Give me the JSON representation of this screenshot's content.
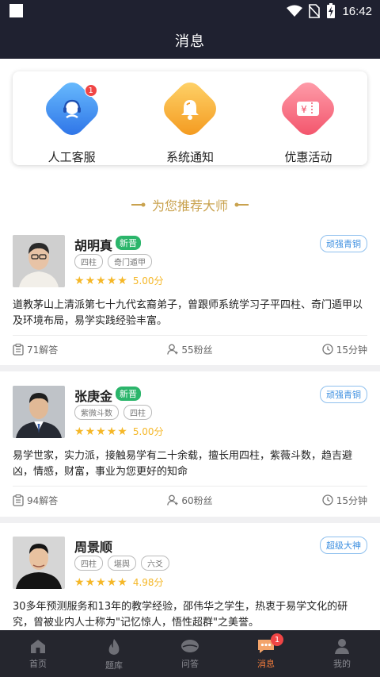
{
  "status_bar": {
    "time": "16:42"
  },
  "header": {
    "title": "消息"
  },
  "quick_actions": [
    {
      "label": "人工客服",
      "icon": "customer-service-icon",
      "badge": "1",
      "color_top": "#5fb4ff",
      "color_bottom": "#2b74e8"
    },
    {
      "label": "系统通知",
      "icon": "bell-icon",
      "color_top": "#ffd36a",
      "color_bottom": "#f49a1c"
    },
    {
      "label": "优惠活动",
      "icon": "coupon-icon",
      "color_top": "#ff9aa6",
      "color_bottom": "#f3556b"
    }
  ],
  "recommend_title": "为您推荐大师",
  "masters": [
    {
      "name": "胡明真",
      "new_tag": "新晋",
      "level": "顽强青铜",
      "tags": [
        "四柱",
        "奇门遁甲"
      ],
      "score": "5.00分",
      "rating": 5,
      "desc": "道教茅山上清派第七十九代玄裔弟子，曾跟师系统学习子平四柱、奇门遁甲以及环境布局，易学实践经验丰富。",
      "answers": "71解答",
      "fans": "55粉丝",
      "time": "15分钟"
    },
    {
      "name": "张庚金",
      "new_tag": "新晋",
      "level": "顽强青铜",
      "tags": [
        "紫微斗数",
        "四柱"
      ],
      "score": "5.00分",
      "rating": 5,
      "desc": "易学世家，实力派，接触易学有二十余载，擅长用四柱，紫薇斗数，趋吉避凶，情感，财富，事业为您更好的知命",
      "answers": "94解答",
      "fans": "60粉丝",
      "time": "15分钟"
    },
    {
      "name": "周景顺",
      "level": "超级大神",
      "tags": [
        "四柱",
        "堪舆",
        "六爻"
      ],
      "score": "4.98分",
      "rating": 5,
      "desc": "30多年预测服务和13年的教学经验，邵伟华之学生，热衷于易学文化的研究，曾被业内人士称为\"记忆惊人，悟性超群\"之美誉。"
    }
  ],
  "tabs": [
    {
      "label": "首页",
      "icon": "home-icon"
    },
    {
      "label": "题库",
      "icon": "flame-icon"
    },
    {
      "label": "问答",
      "icon": "qa-icon"
    },
    {
      "label": "消息",
      "icon": "message-icon",
      "badge": "1",
      "active": true
    },
    {
      "label": "我的",
      "icon": "profile-icon"
    }
  ],
  "colors": {
    "header_bg": "#1f2130",
    "accent_gold": "#c9a24e",
    "tab_active": "#f07b3c",
    "new_tag": "#2bb56b",
    "level_blue": "#3d8fe0"
  }
}
